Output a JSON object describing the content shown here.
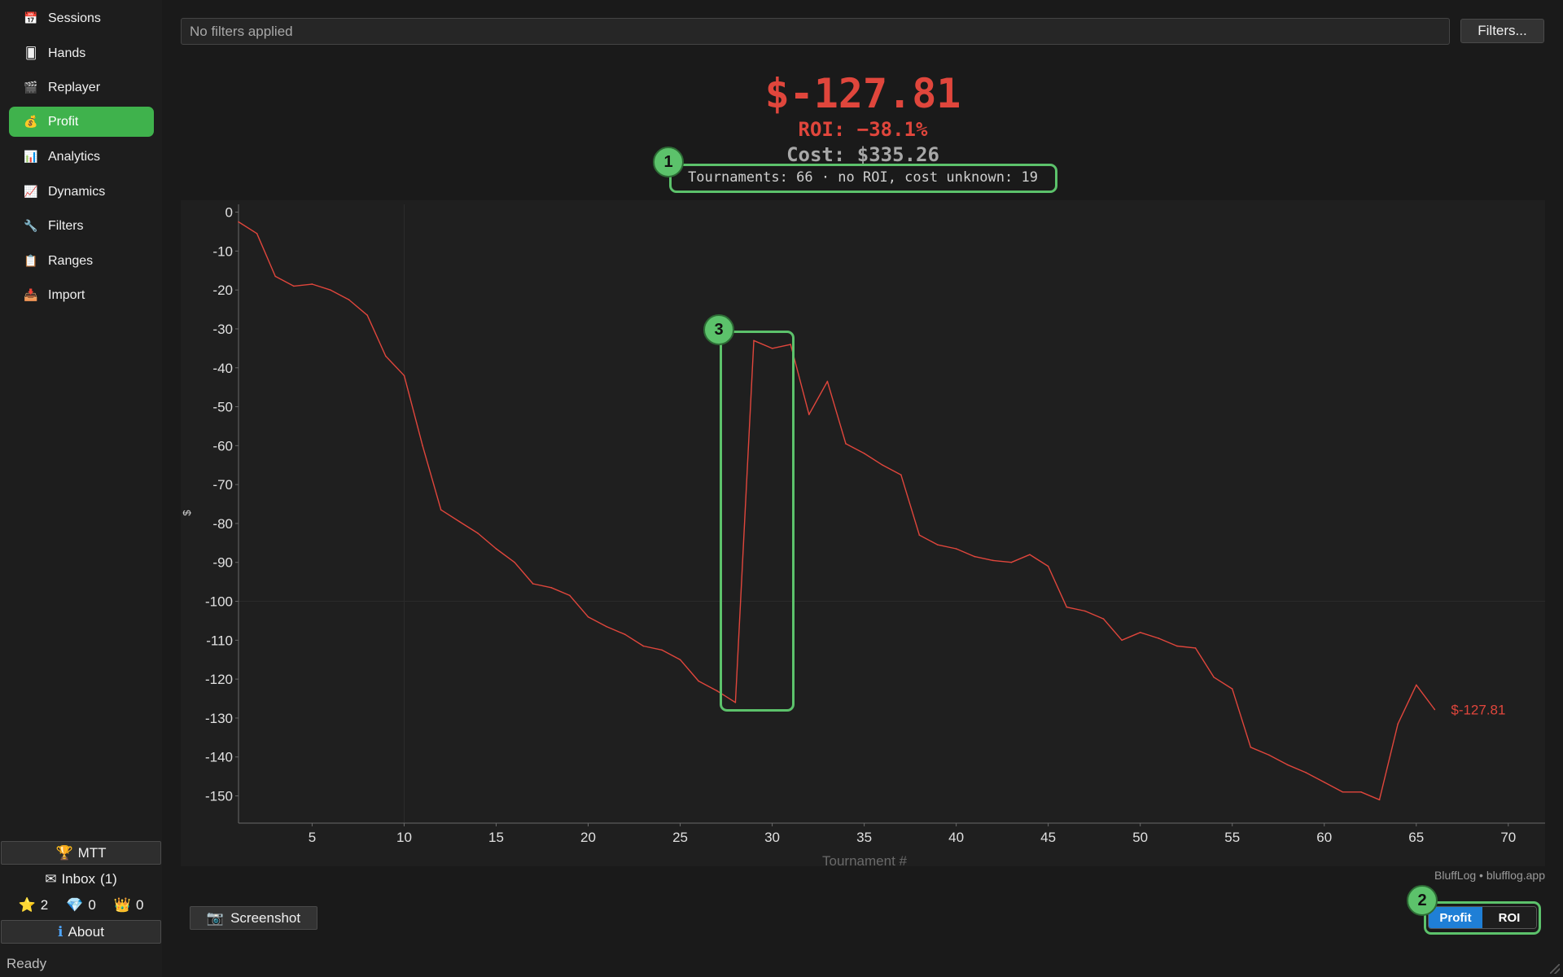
{
  "sidebar": {
    "items": [
      {
        "label": "Sessions",
        "icon": "calendar-icon",
        "glyph": "📅"
      },
      {
        "label": "Hands",
        "icon": "card-icon",
        "glyph": "🂠"
      },
      {
        "label": "Replayer",
        "icon": "clapper-icon",
        "glyph": "🎬"
      },
      {
        "label": "Profit",
        "icon": "moneybag-icon",
        "glyph": "💰",
        "active": true
      },
      {
        "label": "Analytics",
        "icon": "bar-chart-icon",
        "glyph": "📊"
      },
      {
        "label": "Dynamics",
        "icon": "trend-chart-icon",
        "glyph": "📈"
      },
      {
        "label": "Filters",
        "icon": "wrench-icon",
        "glyph": "🔧"
      },
      {
        "label": "Ranges",
        "icon": "clipboard-icon",
        "glyph": "📋"
      },
      {
        "label": "Import",
        "icon": "inbox-tray-icon",
        "glyph": "📥"
      }
    ],
    "mtt_label": "MTT",
    "mtt_glyph": "🏆",
    "inbox_label": "Inbox",
    "inbox_count": "(1)",
    "inbox_glyph": "✉",
    "stars": "2",
    "gems": "0",
    "crowns": "0",
    "about_label": "About",
    "about_glyph": "ℹ"
  },
  "filter_bar": {
    "text": "No filters applied",
    "button_label": "Filters..."
  },
  "stats": {
    "profit": "$-127.81",
    "roi": "ROI: −38.1%",
    "cost": "Cost: $335.26",
    "tournaments": "Tournaments: 66 · no ROI, cost unknown: 19"
  },
  "credit": "BluffLog • blufflog.app",
  "screenshot_label": "Screenshot",
  "screenshot_glyph": "📷",
  "toggle": {
    "profit_label": "Profit",
    "roi_label": "ROI",
    "selected": "Profit"
  },
  "status": "Ready",
  "annotations": [
    "1",
    "2",
    "3"
  ],
  "colors": {
    "accent": "#3fb24c",
    "loss": "#e0463c",
    "toggle_active": "#1f7fd6",
    "annotation": "#5cc26b"
  },
  "chart_data": {
    "type": "line",
    "xlabel": "Tournament #",
    "ylabel": "$",
    "xlim": [
      1,
      72
    ],
    "ylim": [
      -157,
      2
    ],
    "xticks": [
      5,
      10,
      15,
      20,
      25,
      30,
      35,
      40,
      45,
      50,
      55,
      60,
      65,
      70
    ],
    "yticks": [
      0,
      -10,
      -20,
      -30,
      -40,
      -50,
      -60,
      -70,
      -80,
      -90,
      -100,
      -110,
      -120,
      -130,
      -140,
      -150
    ],
    "end_label": "$-127.81",
    "series": [
      {
        "color": "#e0463c",
        "x": [
          1,
          2,
          3,
          4,
          5,
          6,
          7,
          8,
          9,
          10,
          11,
          12,
          13,
          14,
          15,
          16,
          17,
          18,
          19,
          20,
          21,
          22,
          23,
          24,
          25,
          26,
          27,
          28,
          29,
          30,
          31,
          32,
          33,
          34,
          35,
          36,
          37,
          38,
          39,
          40,
          41,
          42,
          43,
          44,
          45,
          46,
          47,
          48,
          49,
          50,
          51,
          52,
          53,
          54,
          55,
          56,
          57,
          58,
          59,
          60,
          61,
          62,
          63,
          64,
          65,
          66
        ],
        "y": [
          -2.5,
          -5.5,
          -16.5,
          -19,
          -18.5,
          -20,
          -22.5,
          -26.5,
          -37,
          -42,
          -60,
          -76.5,
          -79.5,
          -82.5,
          -86.5,
          -90,
          -95.5,
          -96.5,
          -98.5,
          -104,
          -106.5,
          -108.5,
          -111.5,
          -112.5,
          -115,
          -120.5,
          -123,
          -126,
          -33,
          -35,
          -34,
          -52,
          -43.5,
          -59.5,
          -62,
          -65,
          -67.5,
          -83,
          -85.5,
          -86.5,
          -88.5,
          -89.5,
          -90,
          -88,
          -91,
          -101.5,
          -102.5,
          -104.5,
          -110,
          -108,
          -109.5,
          -111.5,
          -112,
          -119.5,
          -122.5,
          -137.5,
          -139.5,
          -142,
          -144,
          -146.5,
          -149,
          -149,
          -151,
          -131.5,
          -121.5,
          -127.81
        ]
      }
    ]
  }
}
